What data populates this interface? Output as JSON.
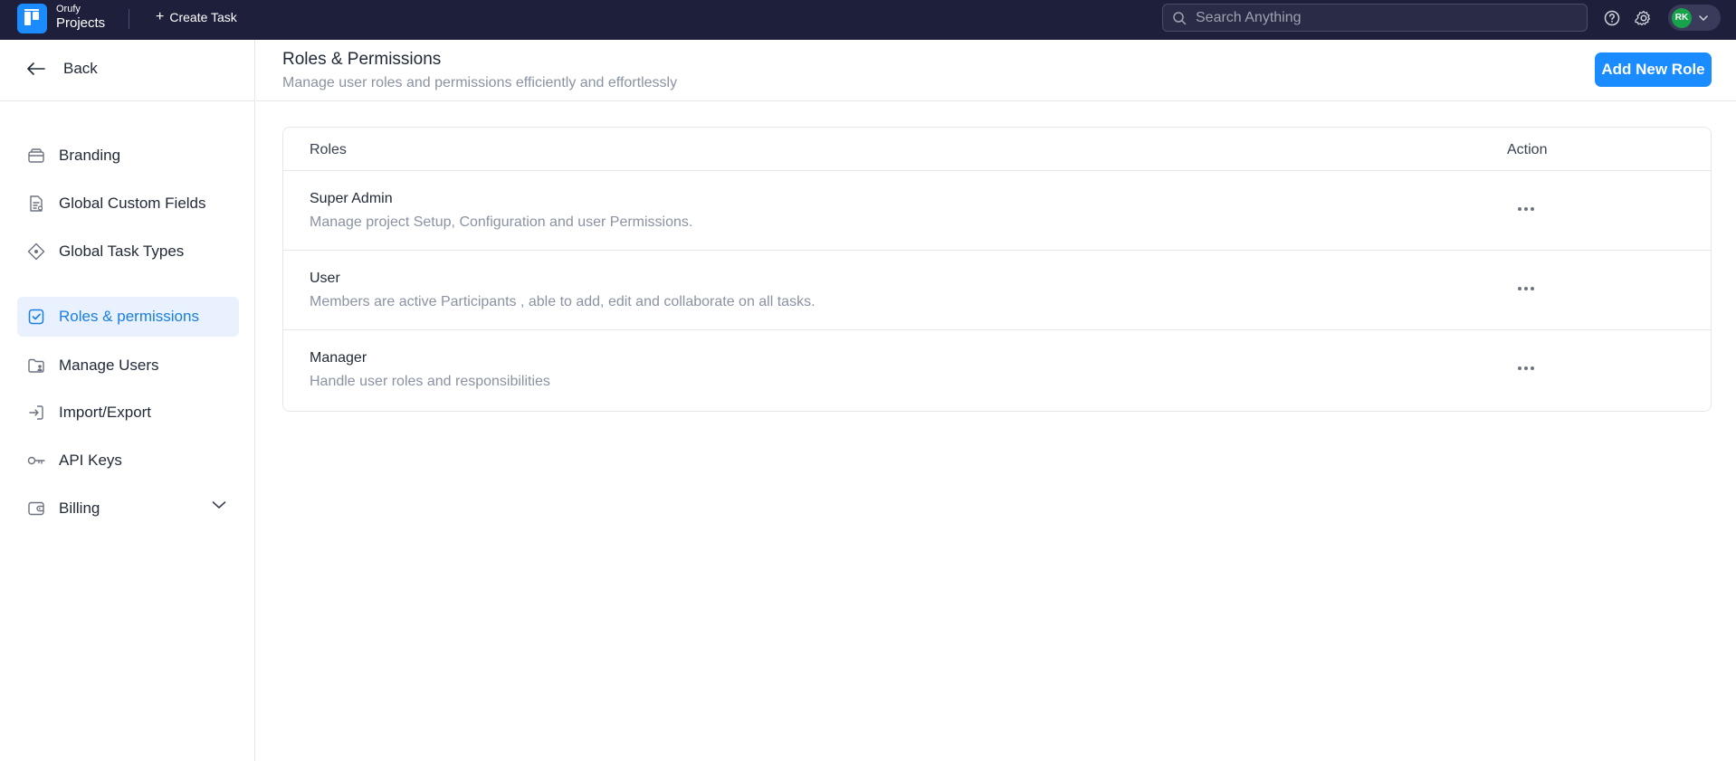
{
  "topbar": {
    "brand_small": "Orufy",
    "brand_big": "Projects",
    "create_task_label": "Create Task",
    "search_placeholder": "Search Anything",
    "avatar_initials": "RK",
    "colors": {
      "bg": "#1e1f3b",
      "accent": "#1a8cff",
      "avatar": "#16a34a"
    }
  },
  "sidebar": {
    "back_label": "Back",
    "items": [
      {
        "label": "Branding",
        "icon": "palette-icon",
        "active": false
      },
      {
        "label": "Global Custom Fields",
        "icon": "document-fields-icon",
        "active": false
      },
      {
        "label": "Global Task Types",
        "icon": "diamond-icon",
        "active": false
      },
      {
        "label": "Roles & permissions",
        "icon": "checkbox-icon",
        "active": true
      },
      {
        "label": "Manage Users",
        "icon": "folder-user-icon",
        "active": false
      },
      {
        "label": "Import/Export",
        "icon": "import-icon",
        "active": false
      },
      {
        "label": "API Keys",
        "icon": "key-icon",
        "active": false
      },
      {
        "label": "Billing",
        "icon": "wallet-icon",
        "active": false,
        "expandable": true
      }
    ]
  },
  "header": {
    "title": "Roles & Permissions",
    "subtitle": "Manage user roles and permissions efficiently and effortlessly",
    "add_button_label": "Add New Role"
  },
  "table": {
    "columns": [
      "Roles",
      "Action"
    ],
    "rows": [
      {
        "name": "Super Admin",
        "description": "Manage project Setup, Configuration and user Permissions."
      },
      {
        "name": "User",
        "description": "Members are active Participants , able to add, edit and collaborate on all tasks."
      },
      {
        "name": "Manager",
        "description": "Handle user roles and responsibilities"
      }
    ]
  }
}
